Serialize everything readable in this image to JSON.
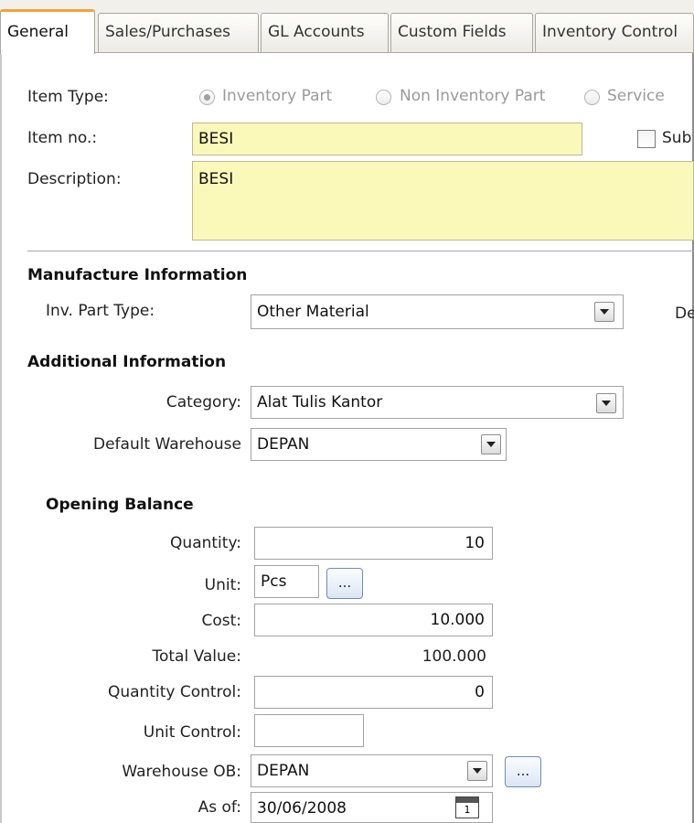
{
  "tabs": [
    {
      "label": "General",
      "active": true
    },
    {
      "label": "Sales/Purchases",
      "active": false
    },
    {
      "label": "GL Accounts",
      "active": false
    },
    {
      "label": "Custom Fields",
      "active": false
    },
    {
      "label": "Inventory Control",
      "active": false
    }
  ],
  "general": {
    "item_type_label": "Item Type:",
    "item_type_options": [
      "Inventory Part",
      "Non Inventory Part",
      "Service"
    ],
    "item_type_selected": "Inventory Part",
    "item_no_label": "Item no.:",
    "item_no_value": "BESI",
    "sub_label": "Sub",
    "description_label": "Description:",
    "description_value": "BESI"
  },
  "manufacture": {
    "title": "Manufacture Information",
    "inv_part_type_label": "Inv. Part Type:",
    "inv_part_type_value": "Other Material",
    "right_label": "De"
  },
  "additional": {
    "title": "Additional Information",
    "category_label": "Category:",
    "category_value": "Alat Tulis Kantor",
    "default_warehouse_label": "Default Warehouse",
    "default_warehouse_value": "DEPAN"
  },
  "opening_balance": {
    "title": "Opening Balance",
    "quantity_label": "Quantity:",
    "quantity_value": "10",
    "unit_label": "Unit:",
    "unit_value": "Pcs",
    "ellipsis": "...",
    "cost_label": "Cost:",
    "cost_value": "10.000",
    "total_value_label": "Total Value:",
    "total_value_value": "100.000",
    "quantity_control_label": "Quantity Control:",
    "quantity_control_value": "0",
    "unit_control_label": "Unit Control:",
    "unit_control_value": "",
    "warehouse_ob_label": "Warehouse OB:",
    "warehouse_ob_value": "DEPAN",
    "as_of_label": "As of:",
    "as_of_value": "30/06/2008",
    "calendar_day": "1"
  }
}
